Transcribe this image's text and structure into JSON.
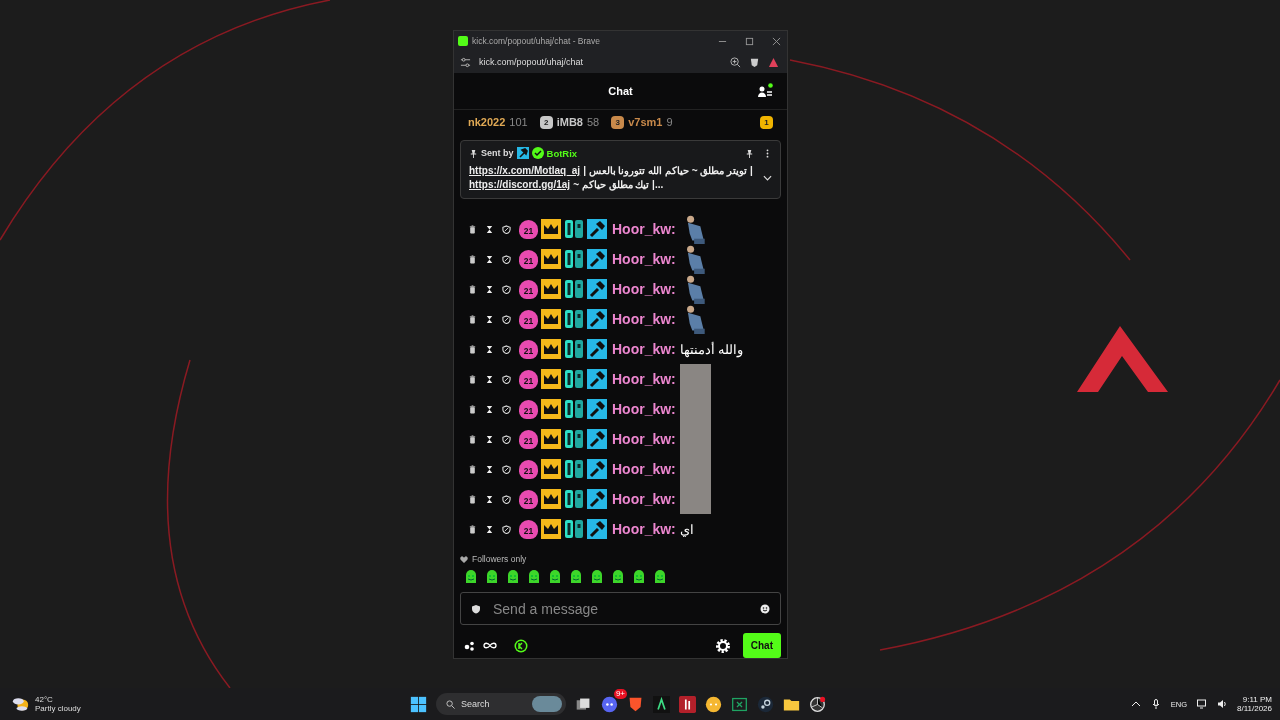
{
  "browser": {
    "title": "kick.com/popout/uhaj/chat - Brave",
    "url": "kick.com/popout/uhaj/chat"
  },
  "chat": {
    "title": "Chat",
    "leaderboard": [
      {
        "name": "nk2022",
        "count": "101",
        "color": "#e0a955"
      },
      {
        "rank": "2",
        "name": "iMB8",
        "count": "58",
        "color": "#c8c8c8"
      },
      {
        "rank": "3",
        "name": "v7sm1",
        "count": "9",
        "color": "#c98a4b"
      },
      {
        "rank": "1",
        "color": "#f0b400"
      }
    ],
    "pinned": {
      "sent_by": "Sent by",
      "author": "BotRix",
      "lines": [
        {
          "link": "https://x.com/Motlaq_aj",
          "text": "| تويتر مطلق ~ حياكم الله تتورونا بالعس |"
        },
        {
          "link": "https://discord.gg/1aj",
          "text": "~ تيك مطلق حياكم |..."
        }
      ]
    },
    "messages": [
      {
        "badge": "21",
        "user": "Hoor_kw:",
        "kind": "emote"
      },
      {
        "badge": "21",
        "user": "Hoor_kw:",
        "kind": "emote"
      },
      {
        "badge": "21",
        "user": "Hoor_kw:",
        "kind": "emote"
      },
      {
        "badge": "21",
        "user": "Hoor_kw:",
        "kind": "emote"
      },
      {
        "badge": "21",
        "user": "Hoor_kw:",
        "kind": "text",
        "text": "والله أدمنتها"
      },
      {
        "badge": "21",
        "user": "Hoor_kw:",
        "kind": "photo"
      },
      {
        "badge": "21",
        "user": "Hoor_kw:",
        "kind": "photo"
      },
      {
        "badge": "21",
        "user": "Hoor_kw:",
        "kind": "photo"
      },
      {
        "badge": "21",
        "user": "Hoor_kw:",
        "kind": "photo"
      },
      {
        "badge": "21",
        "user": "Hoor_kw:",
        "kind": "photo"
      },
      {
        "badge": "21",
        "user": "Hoor_kw:",
        "kind": "text",
        "text": "اي"
      }
    ],
    "mode": "Followers only",
    "input": {
      "placeholder": "Send a message"
    },
    "send_button": "Chat"
  },
  "taskbar": {
    "temperature": "42°C",
    "weather": "Partly cloudy",
    "search": "Search",
    "discord_badge": "9+",
    "language": "ENG",
    "time": "9:11 PM",
    "date": "8/11/2026"
  }
}
